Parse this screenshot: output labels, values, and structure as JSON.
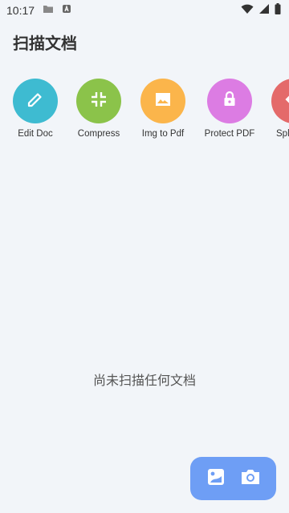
{
  "status_bar": {
    "time": "10:17",
    "icons": [
      "folder-icon",
      "app-notification-icon",
      "wifi-icon",
      "signal-icon",
      "battery-icon"
    ]
  },
  "header": {
    "title": "扫描文档"
  },
  "tools": [
    {
      "label": "Edit Doc",
      "icon": "pencil-icon",
      "color": "#3ebbd1"
    },
    {
      "label": "Compress",
      "icon": "compress-icon",
      "color": "#8bc34a"
    },
    {
      "label": "Img to Pdf",
      "icon": "image-icon",
      "color": "#fbb54b"
    },
    {
      "label": "Protect PDF",
      "icon": "lock-icon",
      "color": "#dc7ce3"
    },
    {
      "label": "Spl",
      "icon": "split-icon",
      "color": "#e46a6a"
    }
  ],
  "empty_state": {
    "message": "尚未扫描任何文档"
  },
  "fab": {
    "background": "#6e9ef5",
    "buttons": [
      "gallery-icon",
      "camera-icon"
    ]
  }
}
